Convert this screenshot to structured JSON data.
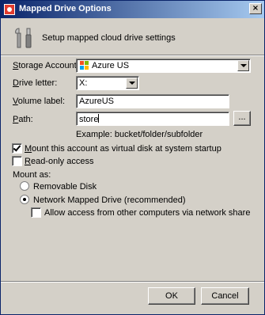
{
  "window": {
    "title": "Mapped Drive Options",
    "close_glyph": "×"
  },
  "header": {
    "text": "Setup mapped cloud drive settings",
    "icon": "tools-icon"
  },
  "form": {
    "storage_account": {
      "label_prefix": "S",
      "label_rest": "torage Account",
      "value": "Azure US",
      "icon": "windows-azure-icon"
    },
    "drive_letter": {
      "label_prefix": "D",
      "label_rest": "rive letter:",
      "value": "X:"
    },
    "volume_label": {
      "label_prefix": "V",
      "label_rest": "olume label:",
      "value": "AzureUS"
    },
    "path": {
      "label_prefix": "P",
      "label_rest": "ath:",
      "value": "store",
      "browse_label": "...",
      "example": "Example: bucket/folder/subfolder"
    }
  },
  "options": {
    "mount_startup": {
      "prefix": "M",
      "rest": "ount this account as virtual disk at system startup",
      "checked": true
    },
    "read_only": {
      "prefix": "R",
      "rest": "ead-only access",
      "checked": false
    }
  },
  "mount_as": {
    "label": "Mount as:",
    "removable": {
      "label": "Removable Disk",
      "selected": false
    },
    "network": {
      "label": "Network Mapped Drive (recommended)",
      "selected": true
    },
    "allow_network": {
      "label": "Allow access from other computers via network share",
      "checked": false
    }
  },
  "buttons": {
    "ok": "OK",
    "cancel": "Cancel"
  }
}
